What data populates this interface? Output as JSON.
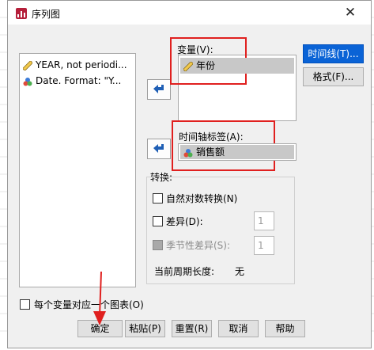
{
  "dialog": {
    "title": "序列图"
  },
  "source_list": {
    "items": [
      {
        "label": "YEAR, not periodi...",
        "icon": "ruler-icon"
      },
      {
        "label": "Date.  Format:  \"Y...",
        "icon": "nominal-balls-icon"
      }
    ]
  },
  "variables": {
    "label": "变量(V):",
    "items": [
      "年份"
    ]
  },
  "time_axis": {
    "label": "时间轴标签(A):",
    "item": "销售额"
  },
  "transform": {
    "label": "转换:",
    "natural_log": "自然对数转换(N)",
    "difference": "差异(D):",
    "difference_value": "1",
    "seasonal_difference": "季节性差异(S):",
    "seasonal_value": "1",
    "period_label": "当前周期长度:",
    "period_value": "无"
  },
  "side_buttons": {
    "time_lines": "时间线(T)...",
    "format": "格式(F)..."
  },
  "one_chart_per_variable": "每个变量对应一个图表(O)",
  "footer": {
    "ok": "确定",
    "paste": "粘贴(P)",
    "reset": "重置(R)",
    "cancel": "取消",
    "help": "帮助"
  },
  "colors": {
    "accent": "#0a63d6",
    "annotation": "#e0201f"
  }
}
